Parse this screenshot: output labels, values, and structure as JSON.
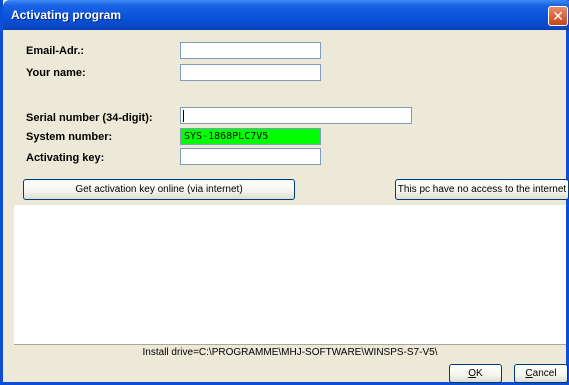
{
  "window": {
    "title": "Activating program",
    "close_glyph": "✕"
  },
  "form": {
    "email_label": "Email-Adr.:",
    "email_value": "",
    "name_label": "Your name:",
    "name_value": "",
    "serial_label": "Serial number (34-digit):",
    "serial_value": "",
    "system_label": "System number:",
    "system_value": "SYS-1868PLC7V5",
    "system_color": "#00ff00",
    "key_label": "Activating key:",
    "key_value": ""
  },
  "buttons": {
    "online": "Get activation key online (via internet)",
    "offline": "This pc have no access to the internet",
    "ok_mnemonic": "O",
    "ok_rest": "K",
    "cancel_mnemonic": "C",
    "cancel_rest": "ancel"
  },
  "status": {
    "install_drive": "Install drive=C:\\PROGRAMME\\MHJ-SOFTWARE\\WINSPS-S7-V5\\"
  },
  "colors": {
    "titlebar": "#0a54dc",
    "dialog_bg": "#ece9d8"
  }
}
